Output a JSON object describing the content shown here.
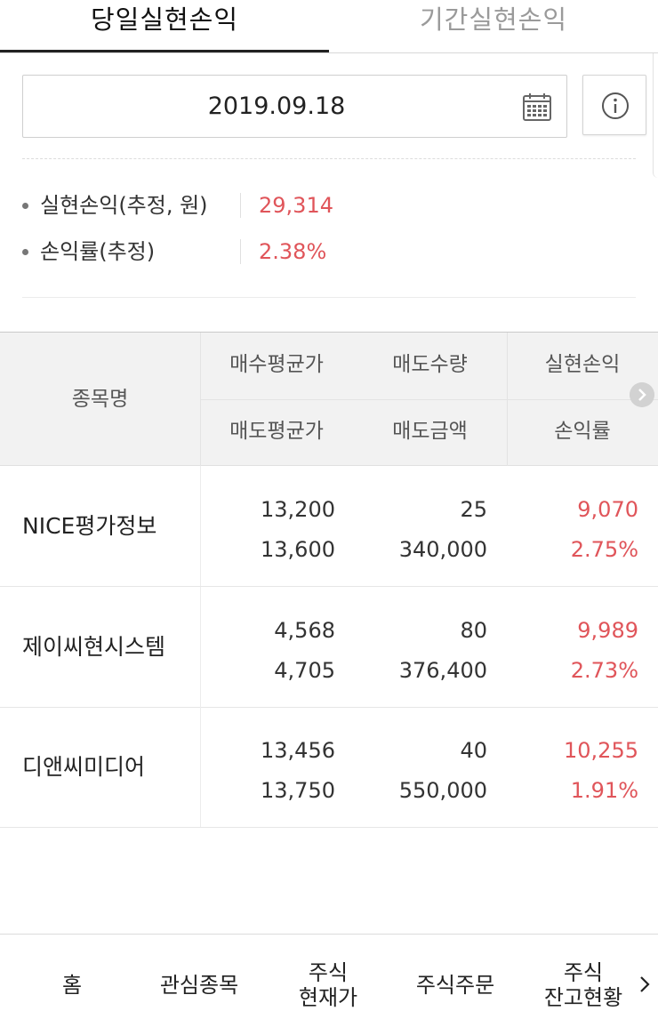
{
  "tabs": [
    {
      "label": "당일실현손익",
      "active": true
    },
    {
      "label": "기간실현손익",
      "active": false
    }
  ],
  "date": {
    "value": "2019.09.18",
    "icon": "calendar-icon"
  },
  "info_button": {
    "icon": "info-icon"
  },
  "summary": [
    {
      "label": "실현손익(추정, 원)",
      "value": "29,314"
    },
    {
      "label": "손익률(추정)",
      "value": "2.38%"
    }
  ],
  "table": {
    "headers": {
      "name": "종목명",
      "top": [
        "매수평균가",
        "매도수량",
        "실현손익"
      ],
      "bottom": [
        "매도평균가",
        "매도금액",
        "손익률"
      ]
    },
    "rows": [
      {
        "name": "NICE평가정보",
        "buy_avg": "13,200",
        "sell_qty": "25",
        "profit": "9,070",
        "sell_avg": "13,600",
        "sell_amount": "340,000",
        "rate": "2.75%"
      },
      {
        "name": "제이씨현시스템",
        "buy_avg": "4,568",
        "sell_qty": "80",
        "profit": "9,989",
        "sell_avg": "4,705",
        "sell_amount": "376,400",
        "rate": "2.73%"
      },
      {
        "name": "디앤씨미디어",
        "buy_avg": "13,456",
        "sell_qty": "40",
        "profit": "10,255",
        "sell_avg": "13,750",
        "sell_amount": "550,000",
        "rate": "1.91%"
      }
    ]
  },
  "bottom_nav": [
    {
      "label": "홈"
    },
    {
      "label": "관심종목"
    },
    {
      "label": "주식\n현재가"
    },
    {
      "label": "주식주문"
    },
    {
      "label": "주식\n잔고현황"
    }
  ],
  "colors": {
    "profit_red": "#e0555a",
    "header_bg": "#f2f2f2"
  }
}
